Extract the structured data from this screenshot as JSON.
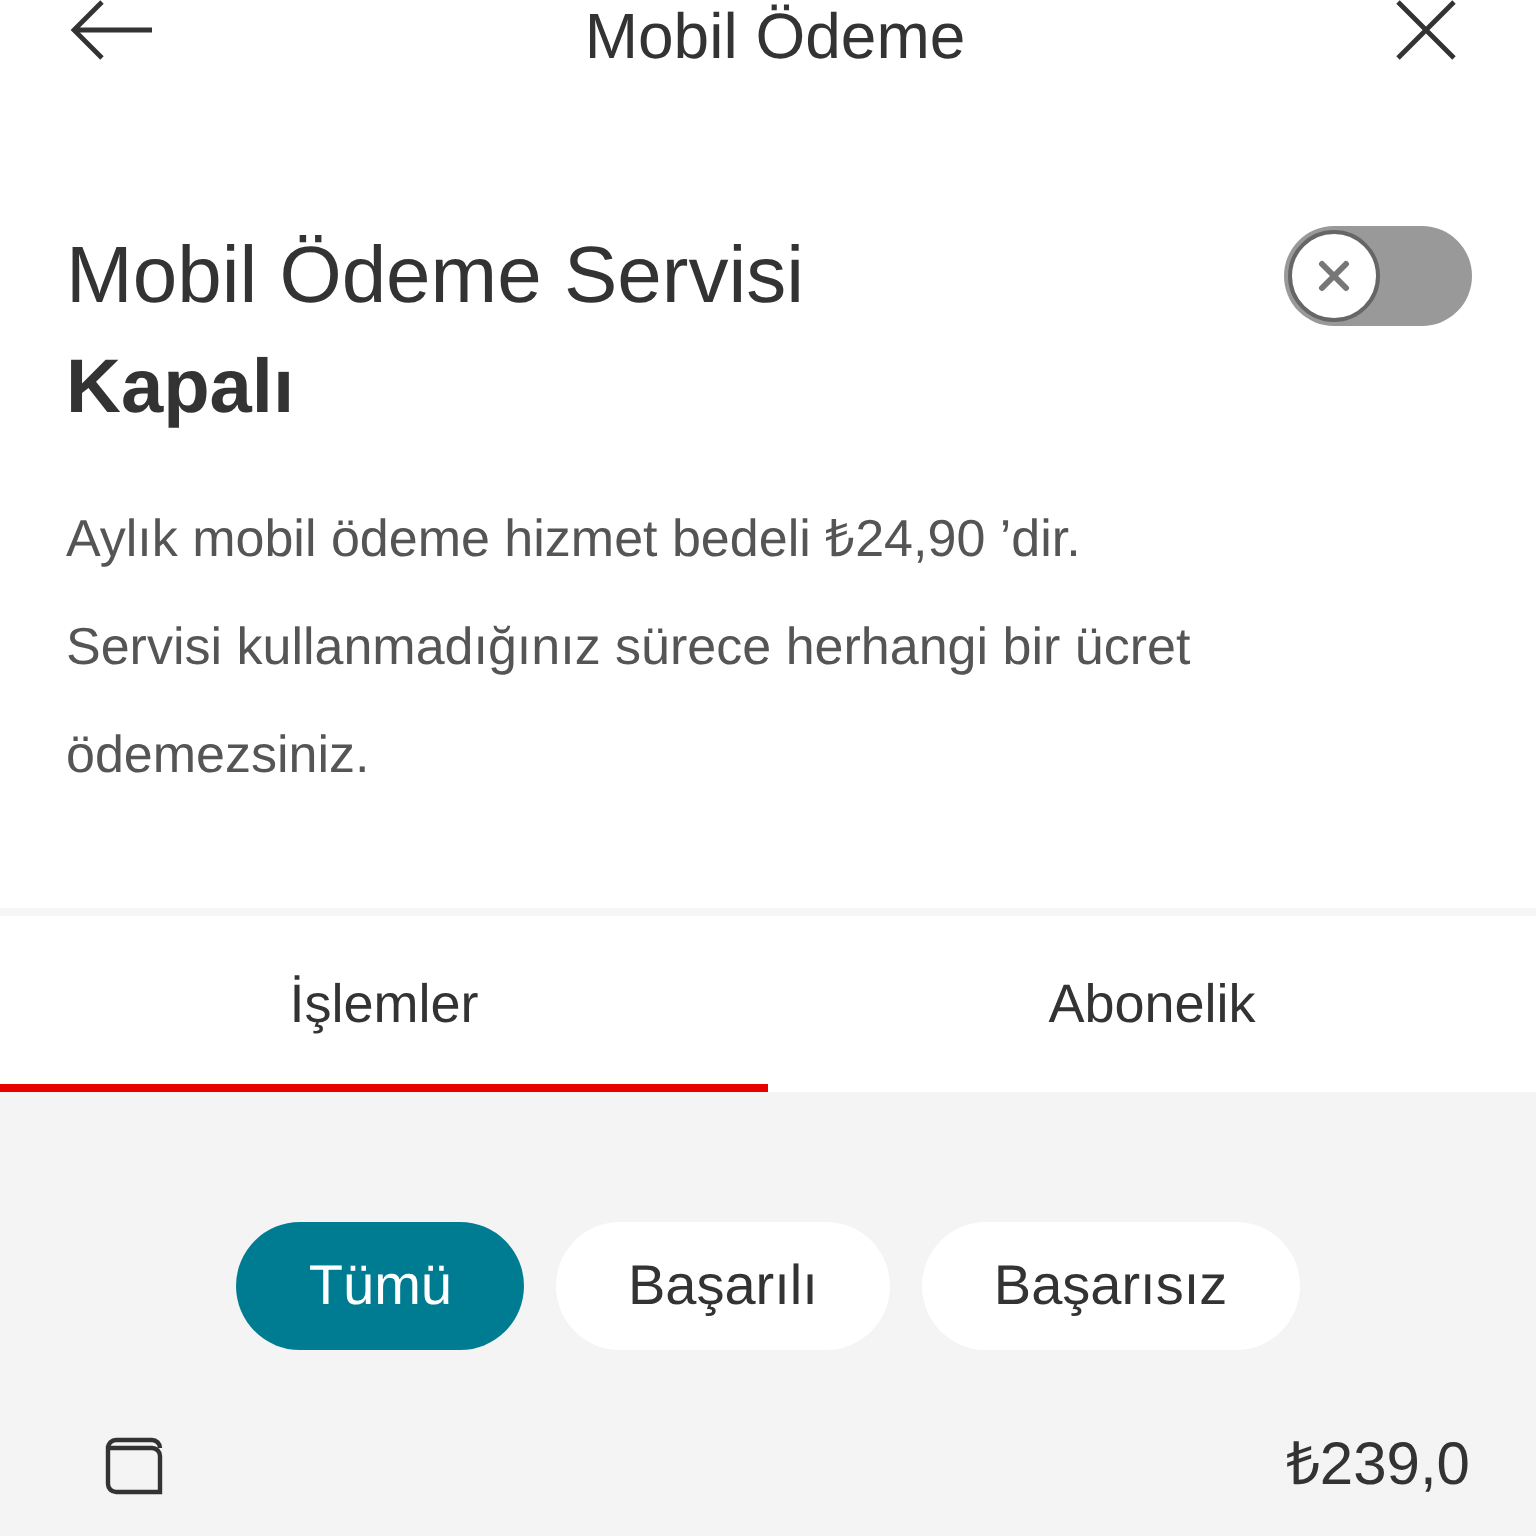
{
  "header": {
    "title": "Mobil Ödeme"
  },
  "service": {
    "title": "Mobil Ödeme Servisi",
    "on": false,
    "status": "Kapalı",
    "description": [
      "Aylık mobil ödeme hizmet bedeli ₺24,90 ’dir.",
      "Servisi kullanmadığınız sürece herhangi bir ücret ödemezsiniz."
    ]
  },
  "tabs": [
    {
      "label": "İşlemler",
      "selected": true
    },
    {
      "label": "Abonelik",
      "selected": false
    }
  ],
  "filters": [
    {
      "label": "Tümü",
      "selected": true
    },
    {
      "label": "Başarılı",
      "selected": false
    },
    {
      "label": "Başarısız",
      "selected": false
    }
  ],
  "transactions": [
    {
      "amount": "₺239,0"
    }
  ]
}
